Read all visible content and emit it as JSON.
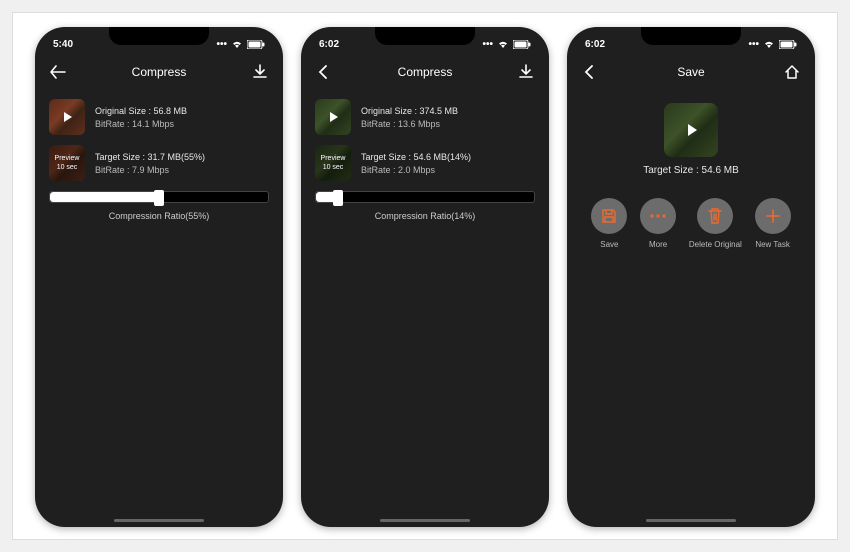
{
  "accent": "#ed6a2e",
  "phones": [
    {
      "time": "5:40",
      "title": "Compress",
      "thumb_style": "red",
      "original_label": "Original Size : 56.8 MB",
      "original_bitrate": "BitRate : 14.1 Mbps",
      "preview_top": "Preview",
      "preview_bottom": "10 sec",
      "target_label": "Target Size : 31.7 MB(55%)",
      "target_bitrate": "BitRate : 7.9 Mbps",
      "ratio_caption": "Compression Ratio(55%)",
      "slider_pct": 55
    },
    {
      "time": "6:02",
      "title": "Compress",
      "thumb_style": "green",
      "original_label": "Original Size : 374.5 MB",
      "original_bitrate": "BitRate : 13.6 Mbps",
      "preview_top": "Preview",
      "preview_bottom": "10 sec",
      "target_label": "Target Size : 54.6 MB(14%)",
      "target_bitrate": "BitRate : 2.0 Mbps",
      "ratio_caption": "Compression Ratio(14%)",
      "slider_pct": 14
    }
  ],
  "save": {
    "time": "6:02",
    "title": "Save",
    "target_label": "Target Size : 54.6 MB",
    "actions": [
      {
        "name": "save",
        "label": "Save"
      },
      {
        "name": "more",
        "label": "More"
      },
      {
        "name": "delete",
        "label": "Delete Original"
      },
      {
        "name": "new",
        "label": "New Task"
      }
    ]
  }
}
